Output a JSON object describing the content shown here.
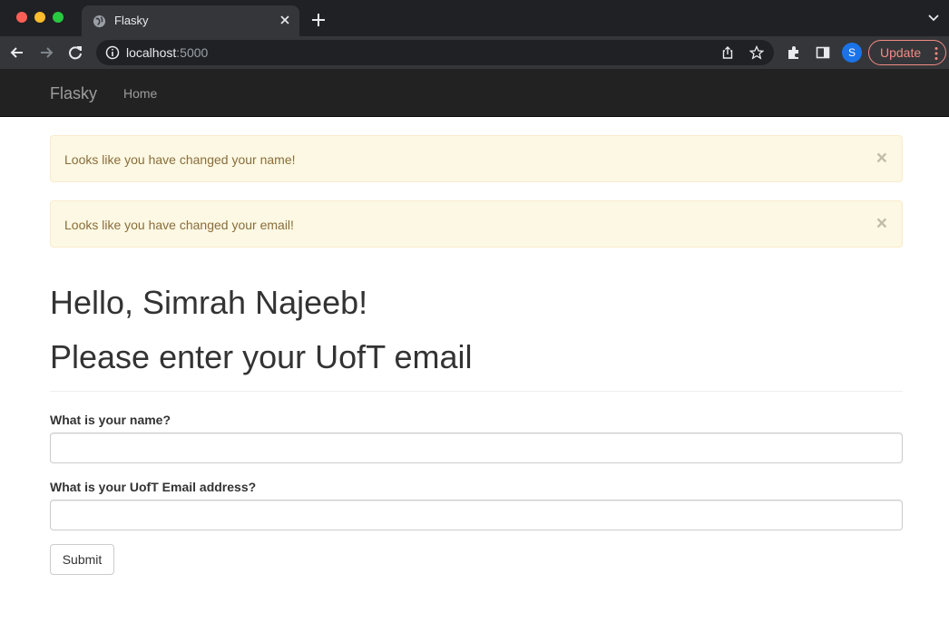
{
  "browser": {
    "tab_title": "Flasky",
    "url_host": "localhost",
    "url_port": ":5000",
    "profile_initial": "S",
    "update_label": "Update",
    "accent_update": "#f28b82"
  },
  "navbar": {
    "brand": "Flasky",
    "items": [
      {
        "label": "Home"
      }
    ]
  },
  "alerts": [
    {
      "message": "Looks like you have changed your name!",
      "close": "×"
    },
    {
      "message": "Looks like you have changed your email!",
      "close": "×"
    }
  ],
  "page": {
    "greeting": "Hello, Simrah Najeeb!",
    "heading": "Please enter your UofT email"
  },
  "form": {
    "name_label": "What is your name?",
    "name_value": "",
    "email_label": "What is your UofT Email address?",
    "email_value": "",
    "submit_label": "Submit"
  },
  "icons": {
    "favicon": "globe-icon",
    "tab_close": "close-icon",
    "new_tab": "plus-icon",
    "tab_list": "chevron-down-icon",
    "back": "arrow-left-icon",
    "forward": "arrow-right-icon",
    "reload": "reload-icon",
    "site_info": "info-icon",
    "share": "share-icon",
    "bookmark": "star-icon",
    "extensions": "puzzle-icon",
    "side_panel": "side-panel-icon",
    "menu": "more-vertical-icon"
  }
}
